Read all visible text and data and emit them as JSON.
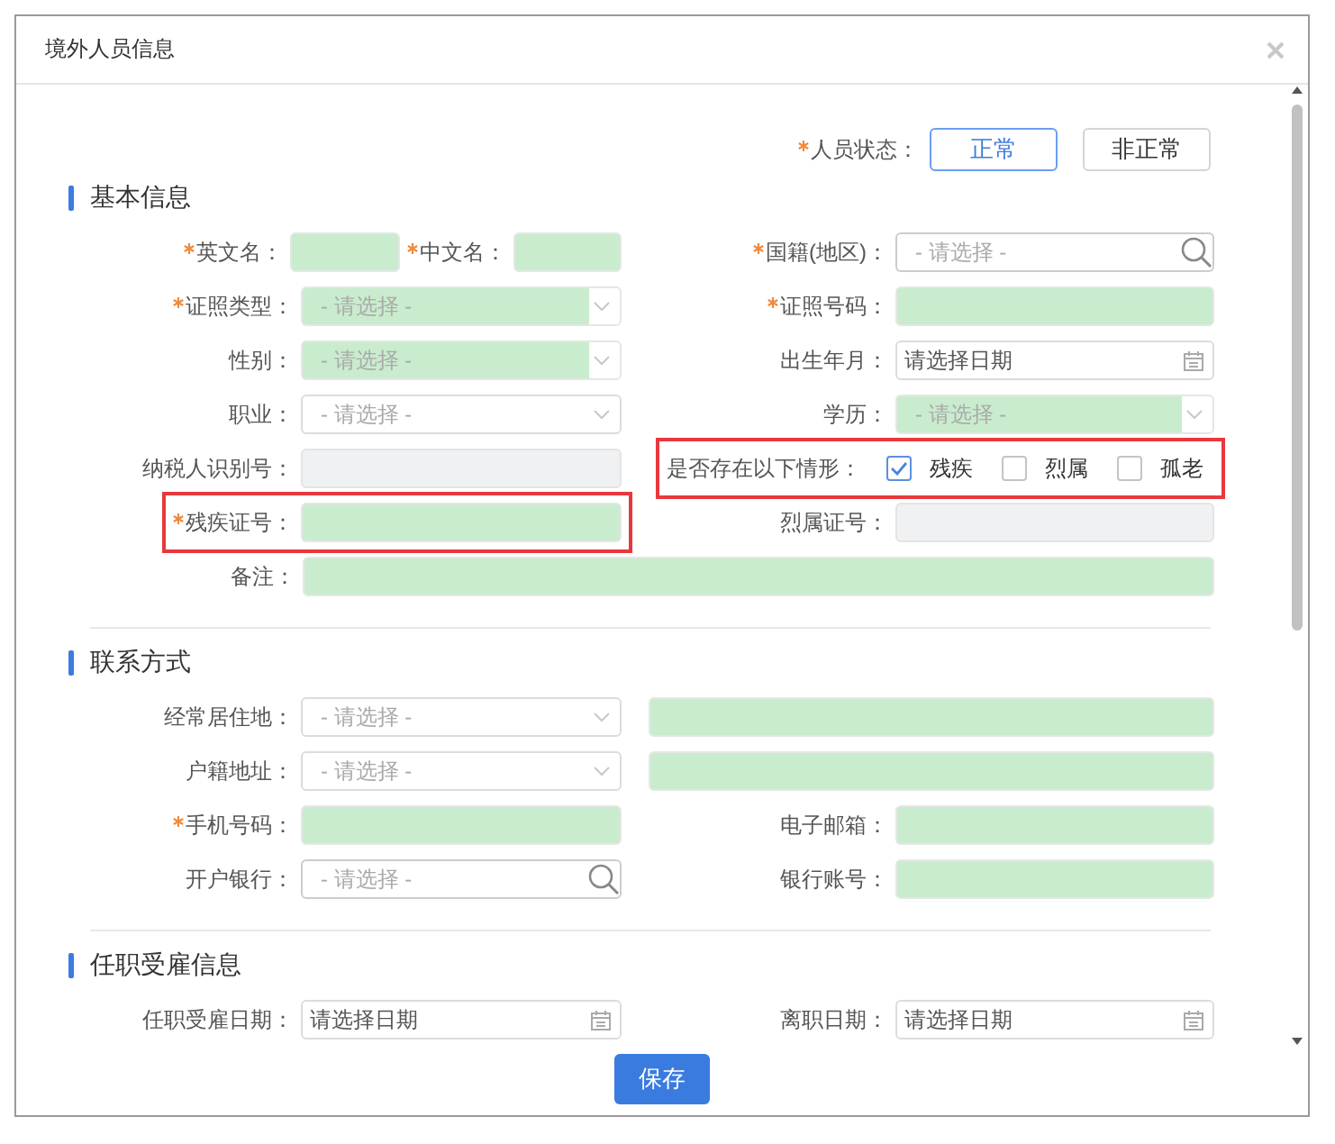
{
  "dialog": {
    "title": "境外人员信息"
  },
  "status": {
    "label": "人员状态：",
    "required": true,
    "options": [
      {
        "label": "正常",
        "selected": true
      },
      {
        "label": "非正常",
        "selected": false
      }
    ]
  },
  "sections": [
    {
      "title": "基本信息",
      "rows": [
        [
          {
            "kind": "text",
            "label": "英文名：",
            "required": true,
            "editable": true,
            "pair": {
              "label": "中文名：",
              "required": true,
              "editable": true
            }
          },
          {
            "kind": "search",
            "label": "国籍(地区)：",
            "required": true,
            "placeholder": "- 请选择 -"
          }
        ],
        [
          {
            "kind": "select",
            "label": "证照类型：",
            "required": true,
            "editable": true,
            "placeholder": "- 请选择 -"
          },
          {
            "kind": "text",
            "label": "证照号码：",
            "required": true,
            "editable": true
          }
        ],
        [
          {
            "kind": "select",
            "label": "性别：",
            "editable": true,
            "placeholder": "- 请选择 -"
          },
          {
            "kind": "date",
            "label": "出生年月：",
            "placeholder": "请选择日期"
          }
        ],
        [
          {
            "kind": "select",
            "label": "职业：",
            "placeholder": "- 请选择 -"
          },
          {
            "kind": "select",
            "label": "学历：",
            "editable": true,
            "placeholder": "- 请选择 -"
          }
        ],
        [
          {
            "kind": "text",
            "label": "纳税人识别号：",
            "disabled": true
          },
          {
            "kind": "checks",
            "label": "是否存在以下情形：",
            "marked": true,
            "options": [
              {
                "label": "残疾",
                "checked": true
              },
              {
                "label": "烈属",
                "checked": false
              },
              {
                "label": "孤老",
                "checked": false
              }
            ]
          }
        ],
        [
          {
            "kind": "text",
            "label": "残疾证号：",
            "required": true,
            "editable": true,
            "marked": true
          },
          {
            "kind": "text",
            "label": "烈属证号：",
            "disabled": true
          }
        ],
        [
          {
            "kind": "text",
            "label": "备注：",
            "editable": true,
            "wide": true
          }
        ]
      ]
    },
    {
      "title": "联系方式",
      "rows": [
        [
          {
            "kind": "select",
            "label": "经常居住地：",
            "placeholder": "- 请选择 -"
          },
          {
            "kind": "text",
            "editable": true
          }
        ],
        [
          {
            "kind": "select",
            "label": "户籍地址：",
            "placeholder": "- 请选择 -"
          },
          {
            "kind": "text",
            "editable": true
          }
        ],
        [
          {
            "kind": "text",
            "label": "手机号码：",
            "required": true,
            "editable": true
          },
          {
            "kind": "text",
            "label": "电子邮箱：",
            "editable": true
          }
        ],
        [
          {
            "kind": "search",
            "label": "开户银行：",
            "placeholder": "- 请选择 -"
          },
          {
            "kind": "text",
            "label": "银行账号：",
            "editable": true
          }
        ]
      ]
    },
    {
      "title": "任职受雇信息",
      "rows": [
        [
          {
            "kind": "date",
            "label": "任职受雇日期：",
            "placeholder": "请选择日期"
          },
          {
            "kind": "date",
            "label": "离职日期：",
            "placeholder": "请选择日期"
          }
        ]
      ]
    }
  ],
  "save_button": "保存"
}
